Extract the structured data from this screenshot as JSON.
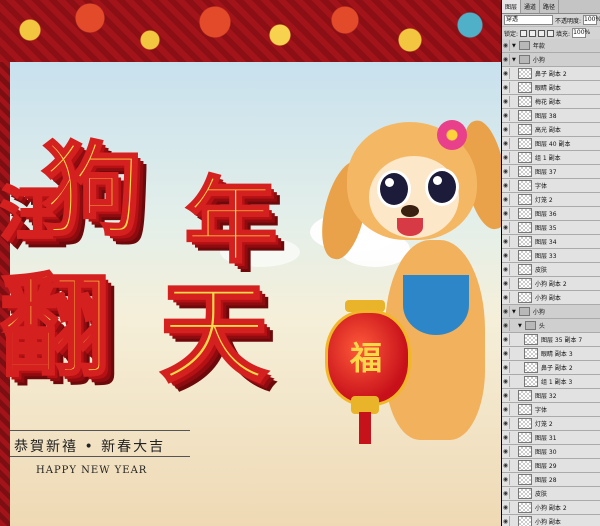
{
  "artwork": {
    "title_chars": [
      "狗",
      "年",
      "翻",
      "天"
    ],
    "partial_chars": [
      "汪"
    ],
    "slogan": "恭賀新禧 • 新春大吉",
    "slogan_en": "HAPPY NEW YEAR",
    "lantern_char": "福"
  },
  "panel": {
    "tabs": [
      "图层",
      "通道",
      "路径"
    ],
    "blend_mode": "穿透",
    "opacity_label": "不透明度:",
    "opacity_value": "100%",
    "lock_label": "锁定:",
    "fill_label": "填充:",
    "fill_value": "100%",
    "layers": [
      {
        "name": "年款",
        "kind": "group",
        "indent": 0
      },
      {
        "name": "小狗",
        "kind": "group",
        "indent": 0
      },
      {
        "name": "鼻子 副本 2",
        "kind": "layer",
        "indent": 1
      },
      {
        "name": "眼睛 副本",
        "kind": "layer",
        "indent": 1
      },
      {
        "name": "梅花 副本",
        "kind": "layer",
        "indent": 1
      },
      {
        "name": "图层 38",
        "kind": "layer",
        "indent": 1
      },
      {
        "name": "高光 副本",
        "kind": "layer",
        "indent": 1
      },
      {
        "name": "图层 40 副本",
        "kind": "layer",
        "indent": 1
      },
      {
        "name": "组 1 副本",
        "kind": "layer",
        "indent": 1
      },
      {
        "name": "图层 37",
        "kind": "layer",
        "indent": 1
      },
      {
        "name": "字体",
        "kind": "layer",
        "indent": 1
      },
      {
        "name": "灯笼 2",
        "kind": "layer",
        "indent": 1
      },
      {
        "name": "图层 36",
        "kind": "layer",
        "indent": 1
      },
      {
        "name": "图层 35",
        "kind": "layer",
        "indent": 1
      },
      {
        "name": "图层 34",
        "kind": "layer",
        "indent": 1
      },
      {
        "name": "图层 33",
        "kind": "layer",
        "indent": 1
      },
      {
        "name": "皮肤",
        "kind": "layer",
        "indent": 1
      },
      {
        "name": "小狗 副本 2",
        "kind": "layer",
        "indent": 1
      },
      {
        "name": "小狗 副本",
        "kind": "layer",
        "indent": 1
      },
      {
        "name": "小狗",
        "kind": "group",
        "indent": 0
      },
      {
        "name": "头",
        "kind": "group",
        "indent": 1
      },
      {
        "name": "图层 35 副本 7",
        "kind": "layer",
        "indent": 2
      },
      {
        "name": "眼睛 副本 3",
        "kind": "layer",
        "indent": 2
      },
      {
        "name": "鼻子 副本 2",
        "kind": "layer",
        "indent": 2
      },
      {
        "name": "组 1 副本 3",
        "kind": "layer",
        "indent": 2
      },
      {
        "name": "图层 32",
        "kind": "layer",
        "indent": 1
      },
      {
        "name": "字体",
        "kind": "layer",
        "indent": 1
      },
      {
        "name": "灯笼 2",
        "kind": "layer",
        "indent": 1
      },
      {
        "name": "图层 31",
        "kind": "layer",
        "indent": 1
      },
      {
        "name": "图层 30",
        "kind": "layer",
        "indent": 1
      },
      {
        "name": "图层 29",
        "kind": "layer",
        "indent": 1
      },
      {
        "name": "图层 28",
        "kind": "layer",
        "indent": 1
      },
      {
        "name": "皮肤",
        "kind": "layer",
        "indent": 1
      },
      {
        "name": "小狗 副本 2",
        "kind": "layer",
        "indent": 1
      },
      {
        "name": "小狗 副本",
        "kind": "layer",
        "indent": 1
      }
    ]
  }
}
